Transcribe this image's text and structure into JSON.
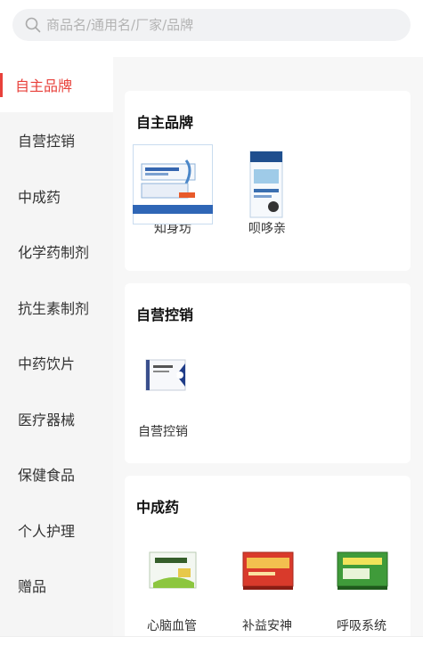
{
  "search": {
    "placeholder": "商品名/通用名/厂家/品牌"
  },
  "sidebar": {
    "items": [
      {
        "label": "自主品牌",
        "active": true
      },
      {
        "label": "自营控销"
      },
      {
        "label": "中成药"
      },
      {
        "label": "化学药制剂"
      },
      {
        "label": "抗生素制剂"
      },
      {
        "label": "中药饮片"
      },
      {
        "label": "医疗器械"
      },
      {
        "label": "保健食品"
      },
      {
        "label": "个人护理"
      },
      {
        "label": "赠品"
      }
    ]
  },
  "sections": [
    {
      "title": "自主品牌",
      "products": [
        {
          "name": "知身坊"
        },
        {
          "name": "呗哆亲"
        }
      ]
    },
    {
      "title": "自营控销",
      "products": [
        {
          "name": "自营控销"
        }
      ]
    },
    {
      "title": "中成药",
      "products": [
        {
          "name": "心脑血管"
        },
        {
          "name": "补益安神"
        },
        {
          "name": "呼吸系统"
        }
      ]
    }
  ],
  "colors": {
    "accent": "#e8413b",
    "sidebar_bg": "#f5f5f5",
    "content_bg": "#f7f7f7"
  },
  "bottom_nav": {
    "icons": [
      "home-icon",
      "category-icon",
      "cart-icon",
      "user-icon"
    ]
  }
}
